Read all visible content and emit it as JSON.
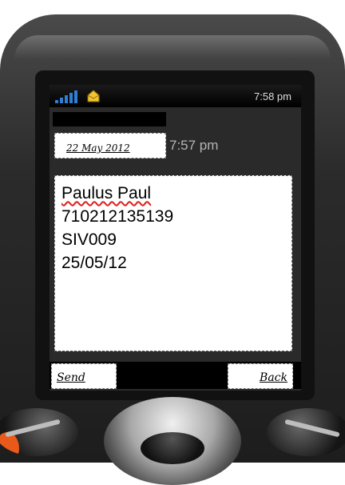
{
  "status_bar": {
    "time": "7:58 pm",
    "signal_icon": "signal-bars-icon",
    "message_icon": "envelope-icon",
    "colors": {
      "signal": "#2f7fd6",
      "message": "#f1c232"
    }
  },
  "message": {
    "date": "22 May 2012",
    "time": "7:57 pm",
    "lines": [
      "Paulus Paul",
      "710212135139",
      "SIV009",
      "25/05/12"
    ]
  },
  "softkeys": {
    "left": "Send",
    "right": "Back"
  },
  "colors": {
    "accent_orange": "#e8591a"
  }
}
